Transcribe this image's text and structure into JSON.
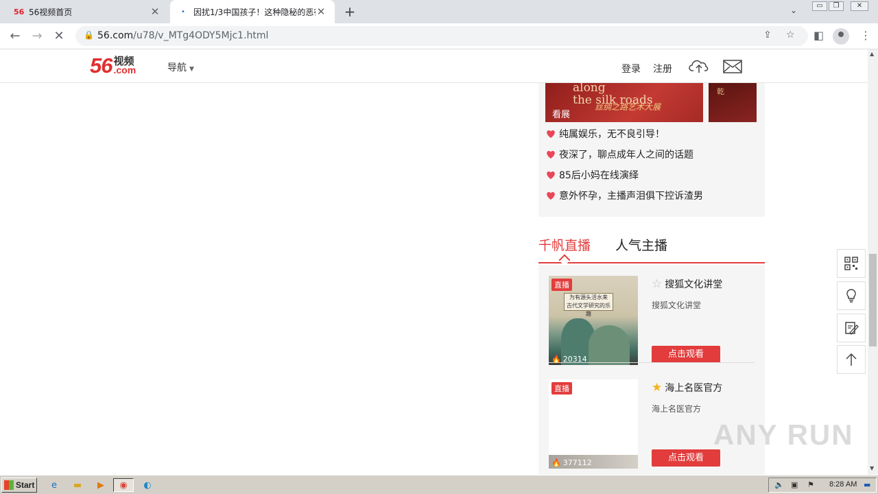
{
  "browser": {
    "tabs": [
      {
        "title": "56视频首页",
        "favicon": "56",
        "active": false
      },
      {
        "title": "因扰1/3中国孩子！这种隐秘的恶行…",
        "favicon": "loading-dot",
        "active": true
      }
    ],
    "url_host": "56.com",
    "url_path": "/u78/v_MTg4ODY5Mjc1.html"
  },
  "site": {
    "logo_number": "56",
    "logo_cn": "视频",
    "logo_com": ".com",
    "nav_label": "导航",
    "login": "登录",
    "register": "注册"
  },
  "sidebar": {
    "banner_en": "along\nthe silk roads",
    "banner_cn": "丝绸之路艺术大展",
    "banner_label": "看展",
    "recommendations": [
      "纯属娱乐，无不良引导！",
      "夜深了，聊点成年人之间的话题",
      "85后小妈在线演绎",
      "意外怀孕，主播声泪俱下控诉渣男"
    ],
    "live_tabs": [
      "千帆直播",
      "人气主播"
    ],
    "live_cards": [
      {
        "badge": "直播",
        "viewers": "20314",
        "anchor": "搜狐文化讲堂",
        "subtitle": "搜狐文化讲堂",
        "button": "点击观看",
        "favorite": false,
        "thumb_text": "为有源头活水来\n古代文学研究的乐趣"
      },
      {
        "badge": "直播",
        "viewers": "377112",
        "anchor": "海上名医官方",
        "subtitle": "海上名医官方",
        "button": "点击观看",
        "favorite": true
      }
    ]
  },
  "watermark": "ANY RUN",
  "taskbar": {
    "start": "Start",
    "clock": "8:28 AM"
  },
  "colors": {
    "brand_red": "#e33c3c",
    "logo_red": "#e12f2f"
  }
}
